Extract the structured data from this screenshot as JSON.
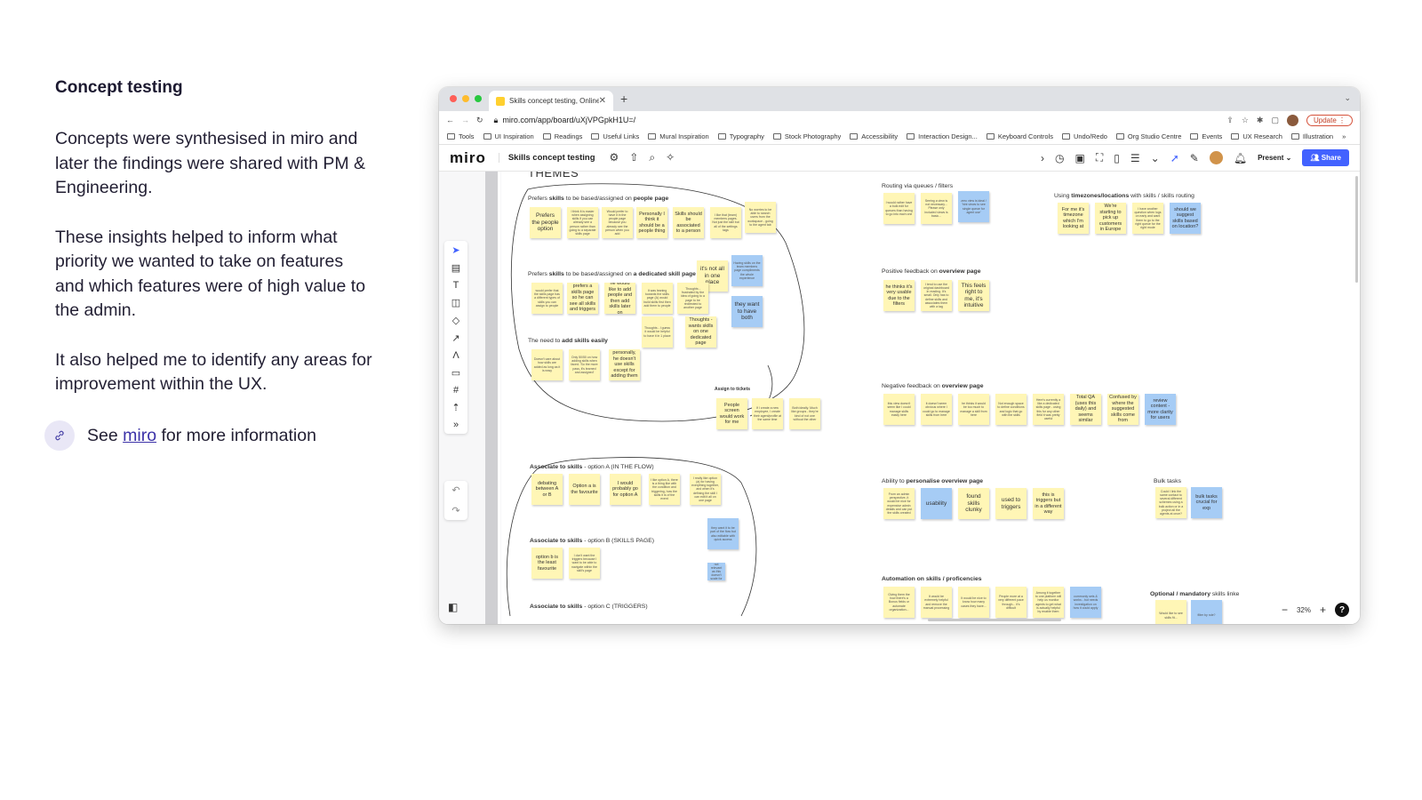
{
  "left_panel": {
    "heading": "Concept testing",
    "paragraphs": [
      "Concepts were synthesised in miro and later the findings were shared with PM & Engineering.",
      "These insights helped to inform what priority we wanted to take on features and which features were of high value to the admin.",
      "It also helped me to identify any areas for improvement within the UX."
    ],
    "see_prefix": "See",
    "see_link": "miro",
    "see_suffix": "for more information"
  },
  "browser": {
    "tab_title": "Skills concept testing, Online W",
    "url": "miro.com/app/board/uXjVPGpkH1U=/",
    "update_label": "Update",
    "bookmarks": [
      "Tools",
      "UI Inspiration",
      "Readings",
      "Useful Links",
      "Mural Inspiration",
      "Typography",
      "Stock Photography",
      "Accessibility",
      "Interaction Design...",
      "Keyboard Controls",
      "Undo/Redo",
      "Org Studio Centre",
      "Events",
      "UX Research",
      "Illustration"
    ]
  },
  "miro": {
    "logo": "miro",
    "board_title": "Skills concept testing",
    "present_label": "Present",
    "share_label": "Share",
    "zoom": "32%",
    "help": "?",
    "themes_heading": "THEMES",
    "labels": {
      "people_page_pre": "Prefers ",
      "people_page_b1": "skills",
      "people_page_mid": " to be based/assigned on ",
      "people_page_b2": "people page",
      "dedicated_pre": "Prefers ",
      "dedicated_b1": "skills",
      "dedicated_mid": " to be based/assigned on ",
      "dedicated_b2": "a dedicated skill page",
      "add_pre": "The need to ",
      "add_b": "add skills easily",
      "assign_tickets": "Assign to tickets",
      "routing": "Routing via queues / filters",
      "timezones_pre": "Using ",
      "timezones_b": "timezones/locations",
      "timezones_post": " with skills / skills routing",
      "positive_pre": "Positive feedback on ",
      "positive_b": "overview page",
      "negative_pre": "Negative feedback on ",
      "negative_b": "overview page",
      "personalise_pre": "Ability to ",
      "personalise_b": "personalise overview page",
      "bulk": "Bulk tasks",
      "automation_b": "Automation on skills / proficencies",
      "optional_b": "Optional / mandatory",
      "optional_post": " skills linke",
      "optA_b": "Associate to skills",
      "optA_post": " - option A (IN THE FLOW)",
      "optB_b": "Associate to skills",
      "optB_post": " - option B (SKILLS PAGE)",
      "optC_b": "Associate to skills",
      "optC_post": " - option C (TRIGGERS)"
    },
    "stickies": {
      "s1": "Prefers the people option",
      "s2": "I think it is easier when assigning skills if you can already see a person rather than going to a separate skills page",
      "s3": "Would prefer to have it in the people page because you already see the person when you add",
      "s4": "Personally I think it should be a people thing",
      "s5": "Skills should be associated to a person",
      "s6": "I like that (team) members pages. Not just the skill but all of the settings tags",
      "s7": "No worries to be able to search users from the workspace - going to the agent tab",
      "d1": "would prefer that the skills page has a different types of skills you can assign to people",
      "d2": "prefers a skills page so he can see all skills and triggers",
      "d3": "he would like to add people and then add skills later on",
      "d4": "It was leaning towards the skills page (A) would build skills first then add them to people",
      "d5": "it's not all in one place",
      "d6": "Having skills on the team members page compliments the whole experience",
      "d7": "Thoughts - frustrated by the idea of going to a page to be redirected to another page",
      "d8": "they want to have both",
      "d9": "Thoughts - I guess it would be helpful to have it in 1 place",
      "d10": "Thoughts - wants skills on one dedicated page",
      "a1": "Doesn't care about how skills are added as long as it is easy",
      "a2": "Only 50/50 on how adding skills when faced. 'So the more pass, it's learned and assigned'",
      "a3": "personally, he doesn't use skills except for adding them",
      "t1": "People screen would work for me",
      "t2": "If I create a new employee, I create their agent/profile at the same time",
      "t3": "Both ideally. Much like groups - they're kind of not one without the other",
      "r1": "I would rather have a bulk edit for queues than having to go into each one",
      "r2": "Seeing a view is not necessary... Please only included views is basic...",
      "r3": "zero view is ideal / 'hint views to see single queue for agent use'",
      "z1": "For me it's timezone which I'm looking at",
      "z2": "We're starting to pick up customers in Europe",
      "z3": "I have another question when logs on early and want them to go to the right queue for the right mode",
      "z4": "should we suggest skills based on location?",
      "p1": "he thinks it's very usable due to the filters",
      "p2": "I tend to use the original dashboard in reading. It's small. Only has to define skills and associates them with a tag",
      "p3": "This feels right to me, it's intuitive",
      "n1": "this view doesn't seem like I could manage skills easily here",
      "n2": "it doesn't seem obvious where I could go to manage skills from here",
      "n3": "he thinks it would be too much to manage a skill from here",
      "n4": "Not enough space to define conditions and logic that go with the skills",
      "n5": "Here's currently a like a dedicated skills page - using this for any other field it was pretty useful",
      "n6": "Total QA (uses this daily) and seems similar",
      "n7": "Confused by where the suggested skills come from",
      "n8": "review content - more clarity for users",
      "o1": "From an admin perspective, it would be nice for expensive admin details and can put the skills created",
      "o2": "usability",
      "o3": "found skills clunky",
      "o4": "used to triggers",
      "o5": "this is triggers but in a different way",
      "b1": "Could I link the same contact to several different schemes using a bulk action or in a project all the agents at once?",
      "b2": "bulk tasks crucial for exp",
      "au1": "Giving them the how there's a Bonus fields or automate organization...",
      "au2": "It would be extremely helpful and remove the manual processing",
      "au3": "It would be nice to know how many cases they have...",
      "au4": "People more at a very different pace through... it's difficult",
      "au5": "Among it together to one platform will help us monitor agents to get what is actually helpful by enable them",
      "au6": "commonly sets & works - but needs investigation on how it could apply",
      "op1": "Would like to see skills fit...",
      "op2": "filter by role?",
      "oa1": "debating between A or B",
      "oa2": "Option a is the favourite",
      "oa3": "I would probably go for option A",
      "oa4": "I like option A, there is a thing like with the condition and triggering, how the skills it is of the event",
      "oa5": "I really like option (a) for having everything together, and when it's defining the skill I can edit it all on one page",
      "oa6": "they want it to be part of the flow but also editable with quick access",
      "ob1": "option b is the least favourite",
      "ob2": "I don't want the triggers because I want to be able to navigate within the skill's page",
      "ob3": "not relevant as this doesn't scale for"
    }
  }
}
